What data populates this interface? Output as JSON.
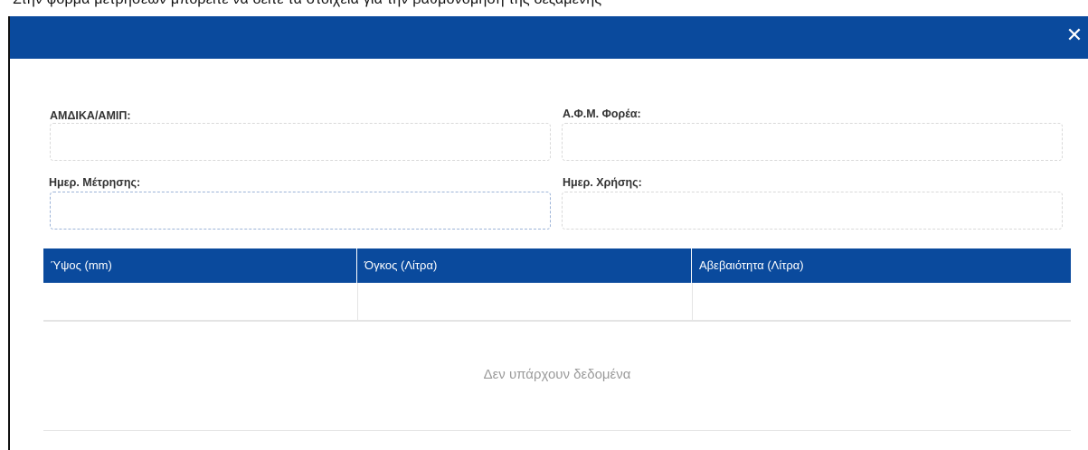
{
  "top_strip": {
    "cut_text": "Στην φόρμα μετρήσεων μπορείτε να δείτε τα στοιχεία για την βαθμονόμηση της δεξαμενής"
  },
  "dialog": {
    "header_color": "#0a4a9d",
    "close_glyph": "✕"
  },
  "form": {
    "amdika_label": "ΑΜΔΙΚΑ/ΑΜΙΠ:",
    "amdika_value": "",
    "afm_label": "Α.Φ.Μ. Φορέα:",
    "afm_value": "",
    "measure_date_label": "Ημερ. Μέτρησης:",
    "measure_date_value": "",
    "use_date_label": "Ημερ. Χρήσης:",
    "use_date_value": ""
  },
  "table": {
    "columns": [
      "Ύψος (mm)",
      "Όγκος (Λίτρα)",
      "Αβεβαιότητα (Λίτρα)"
    ],
    "rows": [],
    "empty_text": "Δεν υπάρχουν δεδομένα"
  }
}
